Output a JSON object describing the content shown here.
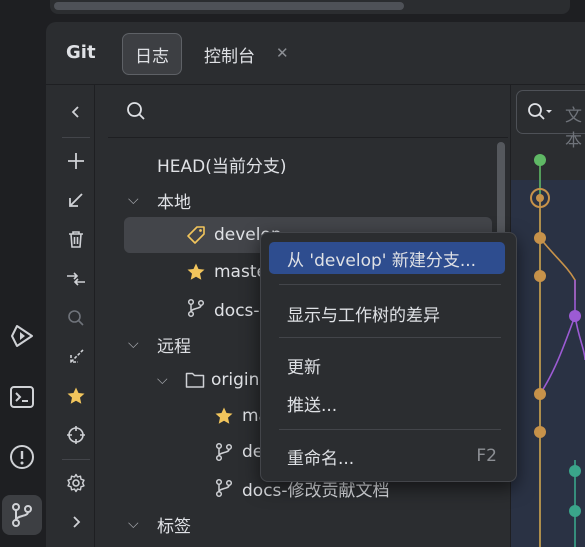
{
  "header": {
    "title": "Git",
    "tabs": [
      {
        "label": "日志"
      },
      {
        "label": "控制台"
      }
    ]
  },
  "tree": {
    "head": "HEAD(当前分支)",
    "local": {
      "label": "本地",
      "items": [
        "develop",
        "master",
        "docs-修改贡献文档"
      ]
    },
    "remote": {
      "label": "远程",
      "origin": "origin",
      "items": [
        "master",
        "develop",
        "docs-修改贡献文档"
      ]
    },
    "tags": {
      "label": "标签"
    }
  },
  "graph": {
    "search_placeholder": "文本"
  },
  "context_menu": {
    "items": [
      {
        "label": "从 'develop' 新建分支...",
        "shortcut": ""
      },
      {
        "label": "显示与工作树的差异",
        "shortcut": ""
      },
      {
        "label": "更新",
        "shortcut": ""
      },
      {
        "label": "推送...",
        "shortcut": ""
      },
      {
        "label": "重命名...",
        "shortcut": "F2"
      }
    ]
  },
  "colors": {
    "accent": "#2e4d8f",
    "selection": "#43454a",
    "star": "#f2c55c",
    "graph_green": "#5fb865",
    "graph_orange": "#c7924a",
    "graph_purple": "#9c5bd4",
    "graph_teal": "#3aa58a"
  }
}
